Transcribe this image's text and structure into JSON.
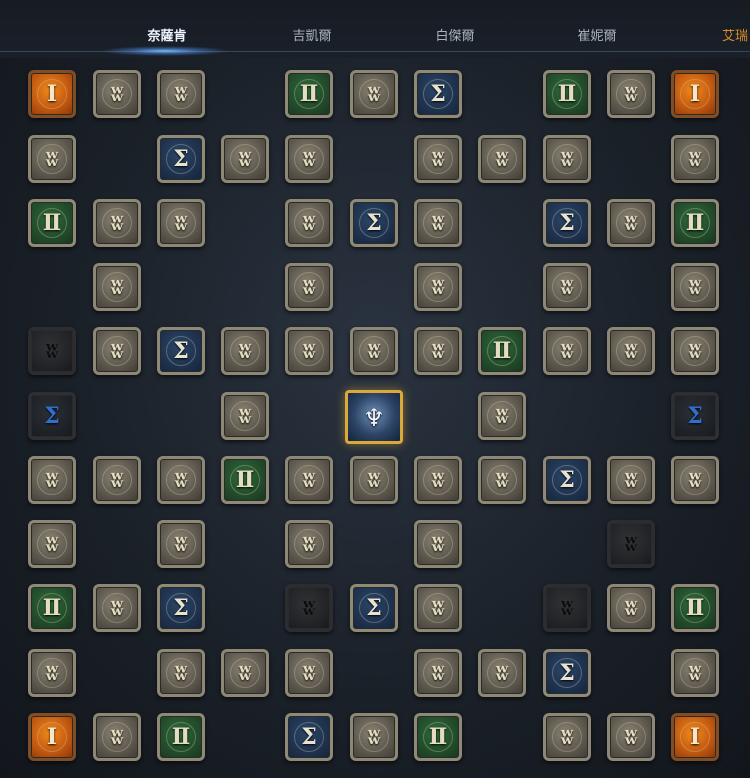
{
  "tabs": [
    {
      "label": "奈薩肯",
      "active": true
    },
    {
      "label": "吉凱爾",
      "active": false
    },
    {
      "label": "白傑爾",
      "active": false
    },
    {
      "label": "崔妮爾",
      "active": false
    },
    {
      "label": "艾瑞",
      "active": false
    }
  ],
  "node_types": {
    "gray": {
      "glyph": "ʬ"
    },
    "green": {
      "glyph": "Ⅱ"
    },
    "blue": {
      "glyph": "Σ"
    },
    "orange": {
      "glyph": "I"
    },
    "black": {
      "glyph": "ʬ"
    },
    "bluedark": {
      "glyph": "Σ"
    }
  },
  "center_node": {
    "glyph": "♆"
  },
  "grid": {
    "columns": 11,
    "rows": [
      [
        "orange",
        "gray",
        "gray",
        null,
        "green",
        "gray",
        "blue",
        null,
        "green",
        "gray",
        "orange"
      ],
      [
        "gray",
        null,
        "blue",
        "gray",
        "gray",
        null,
        "gray",
        "gray",
        "gray",
        null,
        "gray"
      ],
      [
        "green",
        "gray",
        "gray",
        null,
        "gray",
        "blue",
        "gray",
        null,
        "blue",
        "gray",
        "green"
      ],
      [
        null,
        "gray",
        null,
        null,
        "gray",
        null,
        "gray",
        null,
        "gray",
        null,
        "gray"
      ],
      [
        "black",
        "gray",
        "blue",
        "gray",
        "gray",
        "gray",
        "gray",
        "green",
        "gray",
        "gray",
        "gray"
      ],
      [
        "bluedark",
        null,
        null,
        "gray",
        null,
        "center",
        null,
        "gray",
        null,
        null,
        "bluedark"
      ],
      [
        "gray",
        "gray",
        "gray",
        "green",
        "gray",
        "gray",
        "gray",
        "gray",
        "blue",
        "gray",
        "gray"
      ],
      [
        "gray",
        null,
        "gray",
        null,
        "gray",
        null,
        "gray",
        null,
        null,
        "black",
        null
      ],
      [
        "green",
        "gray",
        "blue",
        null,
        "black",
        "blue",
        "gray",
        null,
        "black",
        "gray",
        "green"
      ],
      [
        "gray",
        null,
        "gray",
        "gray",
        "gray",
        null,
        "gray",
        "gray",
        "blue",
        null,
        "gray"
      ],
      [
        "orange",
        "gray",
        "green",
        null,
        "blue",
        "gray",
        "green",
        null,
        "gray",
        "gray",
        "orange"
      ]
    ]
  }
}
